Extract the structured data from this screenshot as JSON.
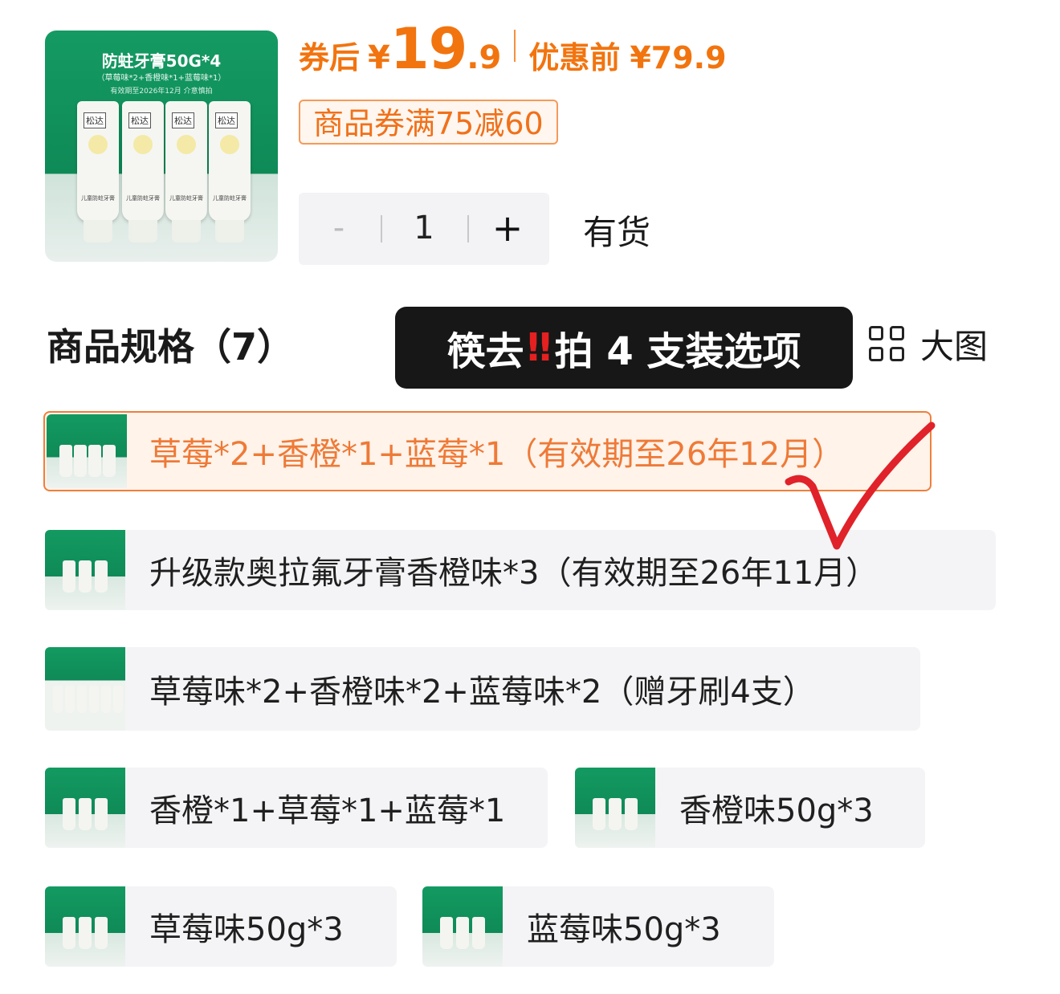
{
  "product": {
    "image": {
      "title": "防蛀牙膏50G*4",
      "subtitle": "（草莓味*2+香橙味*1+蓝莓味*1）",
      "validity": "有效期至2026年12月 介意慎拍",
      "brand": "松达",
      "tube_label": "儿童防蛀牙膏"
    },
    "price": {
      "after_coupon_label": "券后",
      "currency": "¥",
      "after_coupon_int": "19",
      "after_coupon_dec": ".9",
      "before_label": "优惠前",
      "before_price": "¥79.9"
    },
    "coupon": "商品券满75减60",
    "quantity": {
      "minus": "-",
      "value": "1",
      "plus": "+"
    },
    "stock_status": "有货"
  },
  "spec": {
    "title": "商品规格（7）",
    "banner": {
      "part1": "筷去",
      "bang": "‼",
      "part2": "拍 4 支装选项"
    },
    "big_view_label": "大图",
    "options": [
      {
        "label": "草莓*2+香橙*1+蓝莓*1（有效期至26年12月）",
        "selected": true
      },
      {
        "label": "升级款奥拉氟牙膏香橙味*3（有效期至26年11月）",
        "selected": false
      },
      {
        "label": "草莓味*2+香橙味*2+蓝莓味*2（赠牙刷4支）",
        "selected": false
      },
      {
        "label": "香橙*1+草莓*1+蓝莓*1",
        "selected": false
      },
      {
        "label": "香橙味50g*3",
        "selected": false
      },
      {
        "label": "草莓味50g*3",
        "selected": false
      },
      {
        "label": "蓝莓味50g*3",
        "selected": false
      }
    ]
  },
  "colors": {
    "accent": "#f2740f",
    "selected_border": "#ef7f3b",
    "banner_bg": "#171717",
    "check_mark": "#e0222a",
    "product_green": "#0f8a57"
  }
}
